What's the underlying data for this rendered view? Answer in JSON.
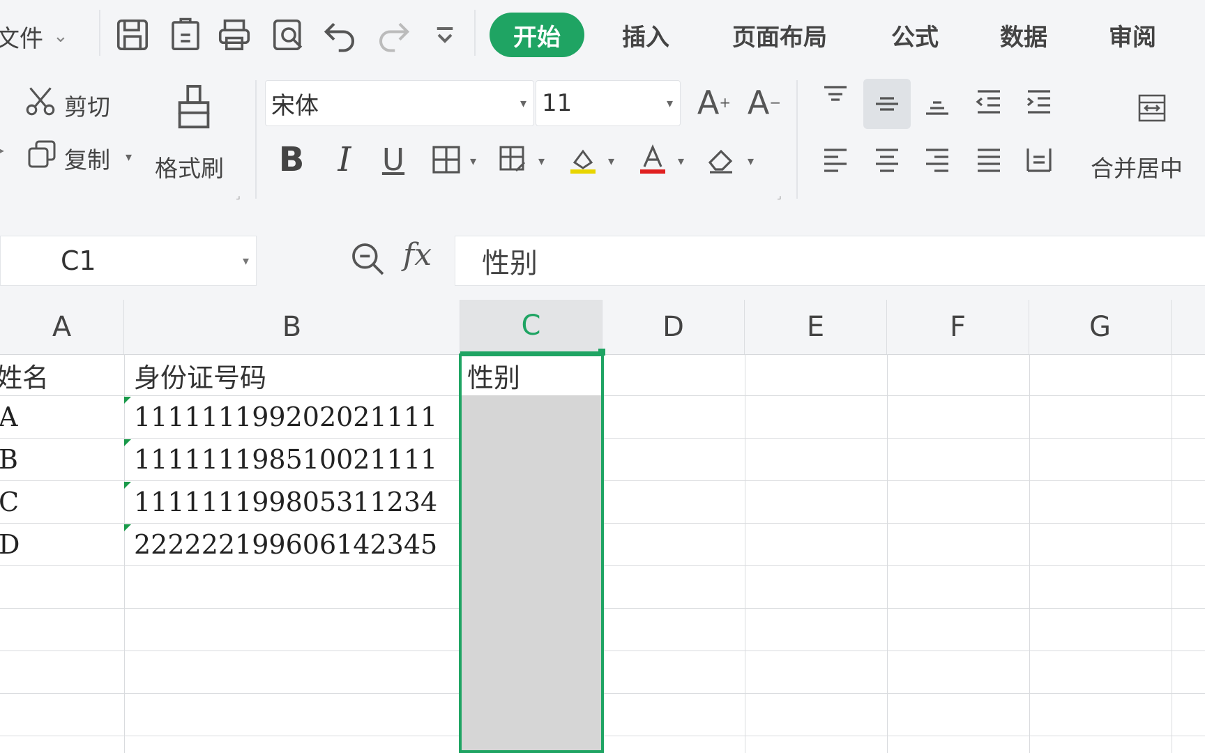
{
  "menu": {
    "file_label": "文件",
    "tabs": [
      {
        "label": "开始",
        "active": true
      },
      {
        "label": "插入"
      },
      {
        "label": "页面布局"
      },
      {
        "label": "公式"
      },
      {
        "label": "数据"
      },
      {
        "label": "审阅"
      }
    ]
  },
  "ribbon": {
    "cut_label": "剪切",
    "copy_label": "复制",
    "format_painter_label": "格式刷",
    "font_name": "宋体",
    "font_size": "11",
    "merge_label": "合并居中"
  },
  "formula_bar": {
    "name_box": "C1",
    "fx": "fx",
    "content": "性别"
  },
  "sheet": {
    "columns": [
      "A",
      "B",
      "C",
      "D",
      "E",
      "F",
      "G"
    ],
    "selected_column": "C",
    "rows": [
      {
        "a": "姓名",
        "b": "身份证号码",
        "c": "性别"
      },
      {
        "a": "A",
        "b": "111111199202021111",
        "c": ""
      },
      {
        "a": "B",
        "b": "111111198510021111",
        "c": ""
      },
      {
        "a": "C",
        "b": "111111199805311234",
        "c": ""
      },
      {
        "a": "D",
        "b": "222222199606142345",
        "c": ""
      }
    ]
  },
  "colors": {
    "accent": "#1fa463",
    "selection_fill": "#d6d6d6",
    "chrome_bg": "#f4f5f7"
  }
}
